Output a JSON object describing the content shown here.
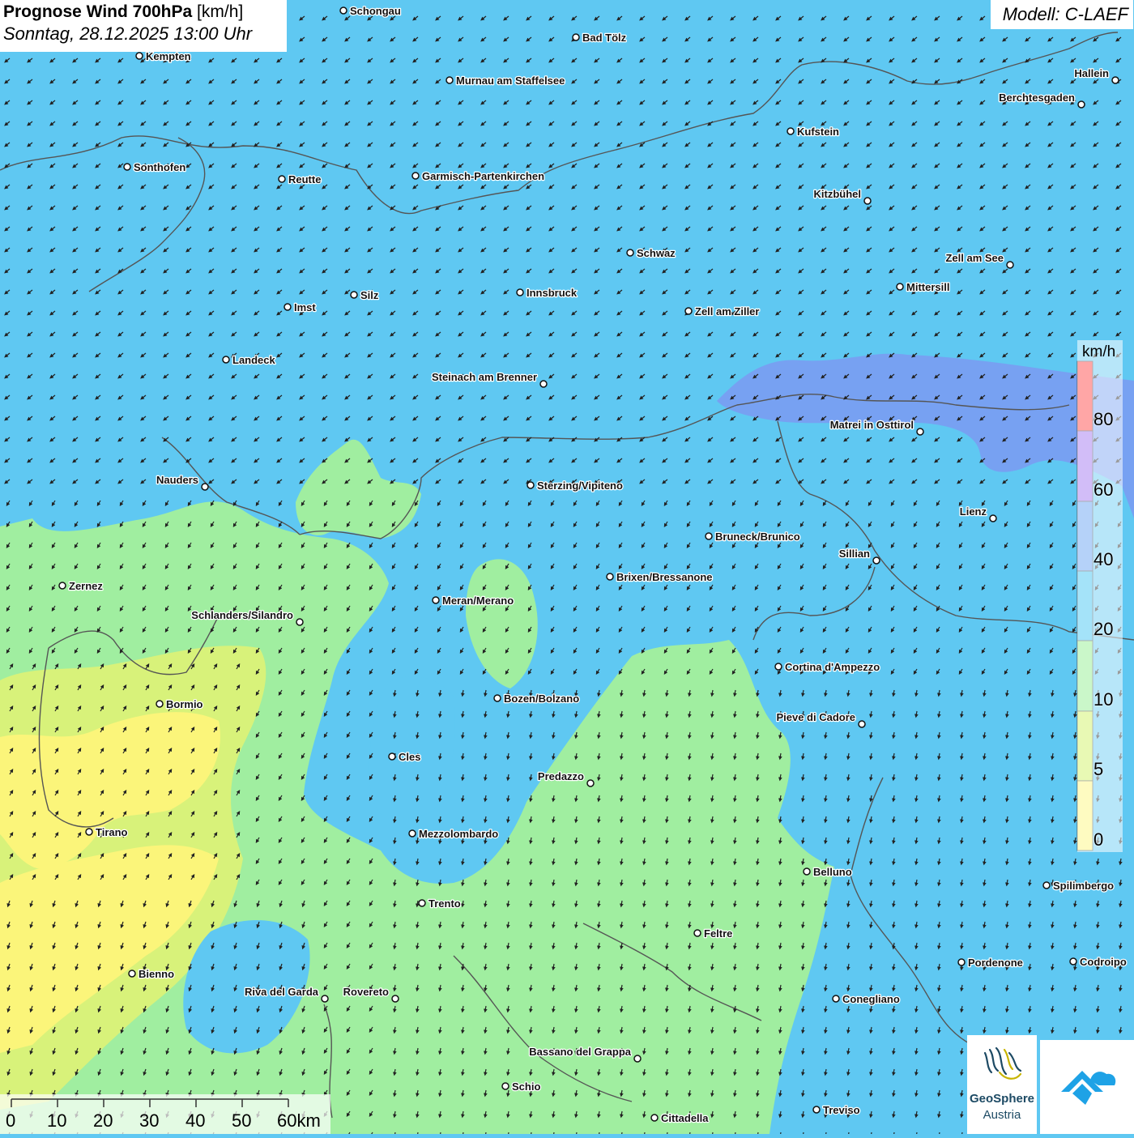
{
  "title": {
    "main": "Prognose Wind 700hPa",
    "unit": "[km/h]",
    "datetime": "Sonntag, 28.12.2025 13:00 Uhr"
  },
  "model": "Modell: C-LAEF",
  "legend": {
    "unit": "km/h",
    "ticks": [
      "80",
      "60",
      "40",
      "20",
      "10",
      "5",
      "0"
    ],
    "colors": [
      "#ff3a3a",
      "#9b6ef0",
      "#5b9cf2",
      "#35c0f2",
      "#8aee88",
      "#cdf25a",
      "#fdf777"
    ]
  },
  "scale_bar": {
    "labels": [
      "0",
      "10",
      "20",
      "30",
      "40",
      "50",
      "60km"
    ]
  },
  "logos": {
    "geosphere_name": "GeoSphere",
    "geosphere_sub": "Austria",
    "icons": [
      "geosphere-logo-icon",
      "weather-app-logo-icon"
    ]
  },
  "colors": {
    "wind_20_40": "#5fc8f2",
    "wind_10_20": "#a0eea0",
    "wind_5_10": "#d8f27a",
    "wind_0_5": "#fbf57a",
    "wind_40_60": "#7a9cf2",
    "borders": "#555555"
  },
  "cities": [
    {
      "name": "Schongau"
    },
    {
      "name": "Bad Tölz"
    },
    {
      "name": "Kempten"
    },
    {
      "name": "Murnau am Staffelsee"
    },
    {
      "name": "Hallein"
    },
    {
      "name": "Berchtesgaden"
    },
    {
      "name": "Kufstein"
    },
    {
      "name": "Sonthofen"
    },
    {
      "name": "Reutte"
    },
    {
      "name": "Garmisch-Partenkirchen"
    },
    {
      "name": "Kitzbühel"
    },
    {
      "name": "Schwaz"
    },
    {
      "name": "Zell am See"
    },
    {
      "name": "Mittersill"
    },
    {
      "name": "Imst"
    },
    {
      "name": "Silz"
    },
    {
      "name": "Innsbruck"
    },
    {
      "name": "Zell am Ziller"
    },
    {
      "name": "Landeck"
    },
    {
      "name": "Steinach am Brenner"
    },
    {
      "name": "Matrei in Osttirol"
    },
    {
      "name": "Nauders"
    },
    {
      "name": "Sterzing/Vipiteno"
    },
    {
      "name": "Lienz"
    },
    {
      "name": "Bruneck/Brunico"
    },
    {
      "name": "Sillian"
    },
    {
      "name": "Brixen/Bressanone"
    },
    {
      "name": "Zernez"
    },
    {
      "name": "Meran/Merano"
    },
    {
      "name": "Schlanders/Silandro"
    },
    {
      "name": "Cortina d'Ampezzo"
    },
    {
      "name": "Bozen/Bolzano"
    },
    {
      "name": "Bormio"
    },
    {
      "name": "Pieve di Cadore"
    },
    {
      "name": "Cles"
    },
    {
      "name": "Predazzo"
    },
    {
      "name": "Tirano"
    },
    {
      "name": "Mezzolombardo"
    },
    {
      "name": "Belluno"
    },
    {
      "name": "Spilimbergo"
    },
    {
      "name": "Trento"
    },
    {
      "name": "Feltre"
    },
    {
      "name": "Pordenone"
    },
    {
      "name": "Codroipo"
    },
    {
      "name": "Bienno"
    },
    {
      "name": "Riva del Garda"
    },
    {
      "name": "Rovereto"
    },
    {
      "name": "Conegliano"
    },
    {
      "name": "Bassano del Grappa"
    },
    {
      "name": "Schio"
    },
    {
      "name": "Treviso"
    },
    {
      "name": "Cittadella"
    }
  ]
}
